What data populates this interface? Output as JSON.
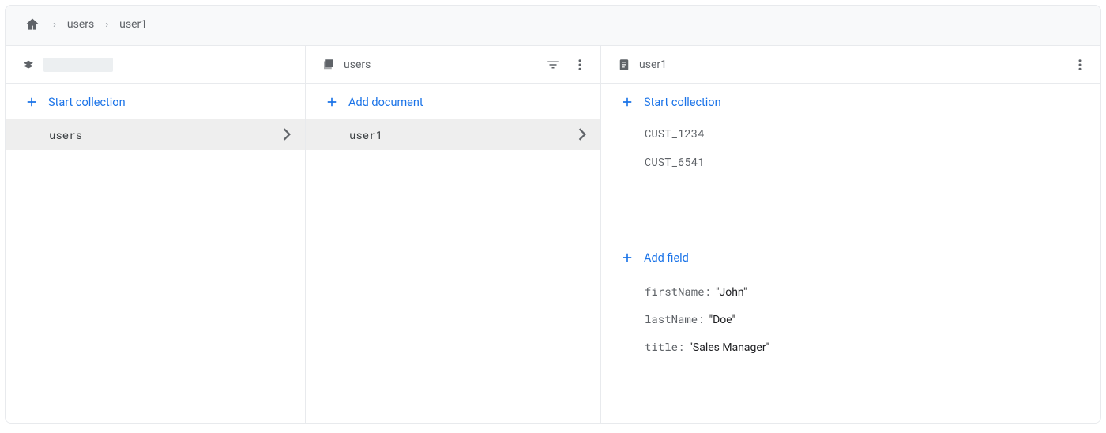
{
  "breadcrumb": {
    "items": [
      "users",
      "user1"
    ]
  },
  "columns": {
    "root": {
      "start_label": "Start collection",
      "items": [
        {
          "label": "users",
          "selected": true
        }
      ]
    },
    "collection": {
      "title": "users",
      "add_label": "Add document",
      "items": [
        {
          "label": "user1",
          "selected": true
        }
      ]
    },
    "document": {
      "title": "user1",
      "start_label": "Start collection",
      "subcollections": [
        "CUST_1234",
        "CUST_6541"
      ],
      "add_field_label": "Add field",
      "fields": [
        {
          "key": "firstName",
          "value": "\"John\""
        },
        {
          "key": "lastName",
          "value": "\"Doe\""
        },
        {
          "key": "title",
          "value": "\"Sales Manager\""
        }
      ]
    }
  }
}
